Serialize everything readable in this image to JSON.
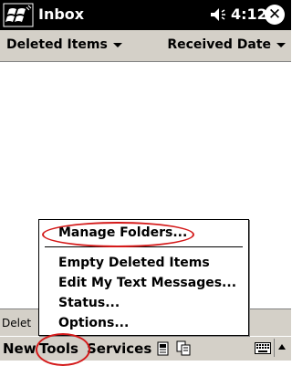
{
  "titlebar": {
    "title": "Inbox",
    "time": "4:12",
    "close_glyph": "✕",
    "icons": [
      "windows-start-icon",
      "speaker-icon",
      "close-icon"
    ]
  },
  "subbar": {
    "folder_label": "Deleted Items",
    "sort_label": "Received Date"
  },
  "status": {
    "text": "Delet"
  },
  "menubar": {
    "new": "New",
    "tools": "Tools",
    "services": "Services",
    "icons": [
      "contacts-icon",
      "sync-icon",
      "keyboard-icon",
      "up-arrow-icon"
    ]
  },
  "tools_menu": {
    "items": [
      "Manage Folders...",
      "Empty Deleted Items",
      "Edit My Text Messages...",
      "Status...",
      "Options..."
    ]
  },
  "colors": {
    "titlebar": "#000000",
    "bar": "#d4d0c8",
    "highlight_ring": "#d41a1a"
  }
}
